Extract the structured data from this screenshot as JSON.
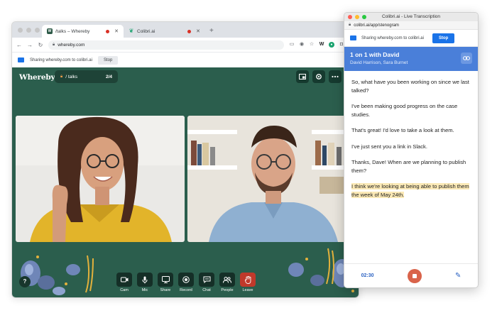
{
  "browser": {
    "tabs": [
      {
        "label": "/talks – Whereby",
        "favicon": "whereby-favicon"
      },
      {
        "label": "Colibri.ai",
        "favicon": "colibri-favicon"
      }
    ],
    "new_tab": "+",
    "url": "whereby.com",
    "share_text": "Sharing whereby.com to colibri.ai",
    "stop_label": "Stop"
  },
  "meeting": {
    "logo": "Whereby",
    "room_name": "/ talks",
    "participant_count": "2/4",
    "help": "?",
    "controls": [
      {
        "label": "Cam",
        "icon": "camera-icon"
      },
      {
        "label": "Mic",
        "icon": "mic-icon"
      },
      {
        "label": "Share",
        "icon": "screen-share-icon"
      },
      {
        "label": "Record",
        "icon": "record-icon"
      },
      {
        "label": "Chat",
        "icon": "chat-icon"
      },
      {
        "label": "People",
        "icon": "people-icon"
      },
      {
        "label": "Leave",
        "icon": "hand-wave-icon"
      }
    ],
    "colors": {
      "background": "#2b5e4d",
      "leave": "#c0392b"
    }
  },
  "popup": {
    "window_title": "Colibri.ai - Live Transcription",
    "url": "colibri.ai/app/stenogram",
    "share_text": "Sharing whereby.com to colibri.ai",
    "stop_label": "Stop",
    "meeting_title": "1 on 1 with David",
    "participants": "David Harrison, Sara Burnet",
    "transcript": [
      {
        "text": "So, what have you been working on since we last talked?",
        "highlight": false
      },
      {
        "text": "I've been making good progress on the case studies.",
        "highlight": false
      },
      {
        "text": "That's great! I'd love to take a look at them.",
        "highlight": false
      },
      {
        "text": "I've just sent you a link in Slack.",
        "highlight": false
      },
      {
        "text": "Thanks, Dave! When are we planning to publish them?",
        "highlight": false
      },
      {
        "text": "I think we're looking at being able to publish them the week of May 24th.",
        "highlight": true
      }
    ],
    "timer": "02:30",
    "colors": {
      "header": "#4a7fd9",
      "record": "#d9634a",
      "highlight": "#fbe9b6"
    }
  }
}
